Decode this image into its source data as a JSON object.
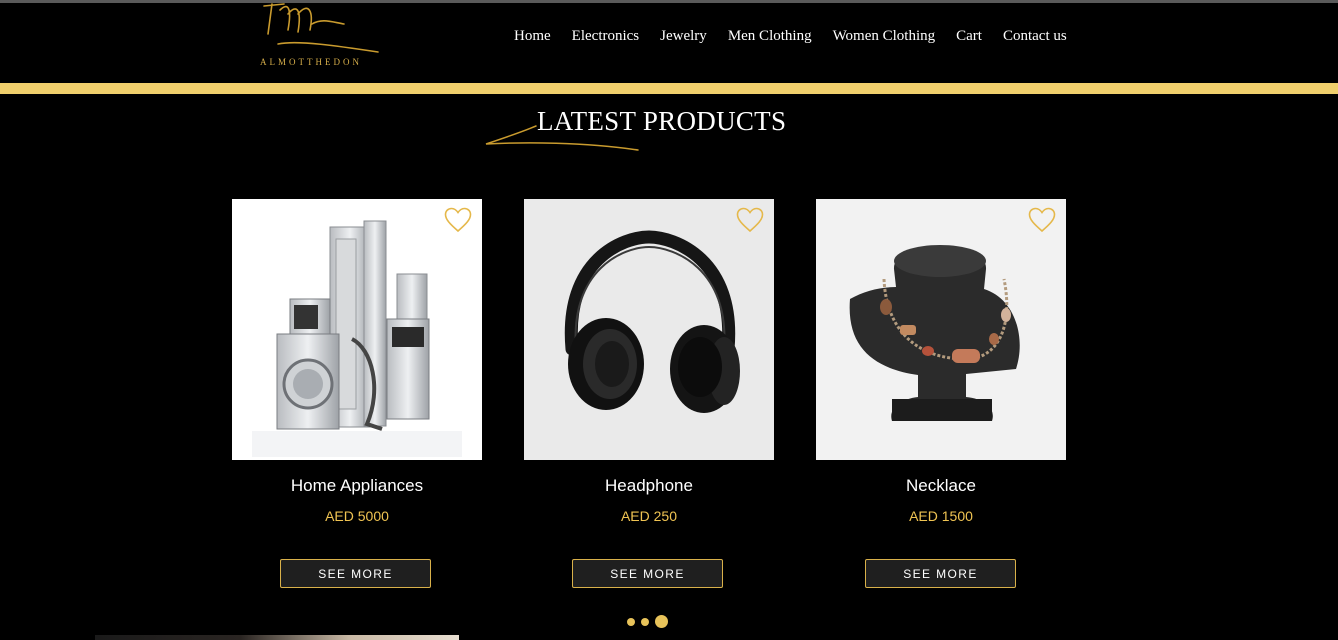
{
  "brand": {
    "logo_text": "ALMOTTHEDON"
  },
  "nav": {
    "items": [
      {
        "label": "Home"
      },
      {
        "label": "Electronics"
      },
      {
        "label": "Jewelry"
      },
      {
        "label": "Men Clothing"
      },
      {
        "label": "Women Clothing"
      },
      {
        "label": "Cart"
      },
      {
        "label": "Contact us"
      }
    ]
  },
  "section": {
    "title": "LATEST PRODUCTS"
  },
  "products": [
    {
      "name": "Home Appliances",
      "price": "AED 5000",
      "button": "SEE MORE",
      "icon": "heart-outline-icon"
    },
    {
      "name": "Headphone",
      "price": "AED 250",
      "button": "SEE MORE",
      "icon": "heart-outline-icon"
    },
    {
      "name": "Necklace",
      "price": "AED 1500",
      "button": "SEE MORE",
      "icon": "heart-outline-icon"
    }
  ],
  "carousel": {
    "pages": 3,
    "active_index": 2
  },
  "colors": {
    "accent": "#f0cf6c",
    "background": "#000000",
    "price": "#f0c453"
  }
}
